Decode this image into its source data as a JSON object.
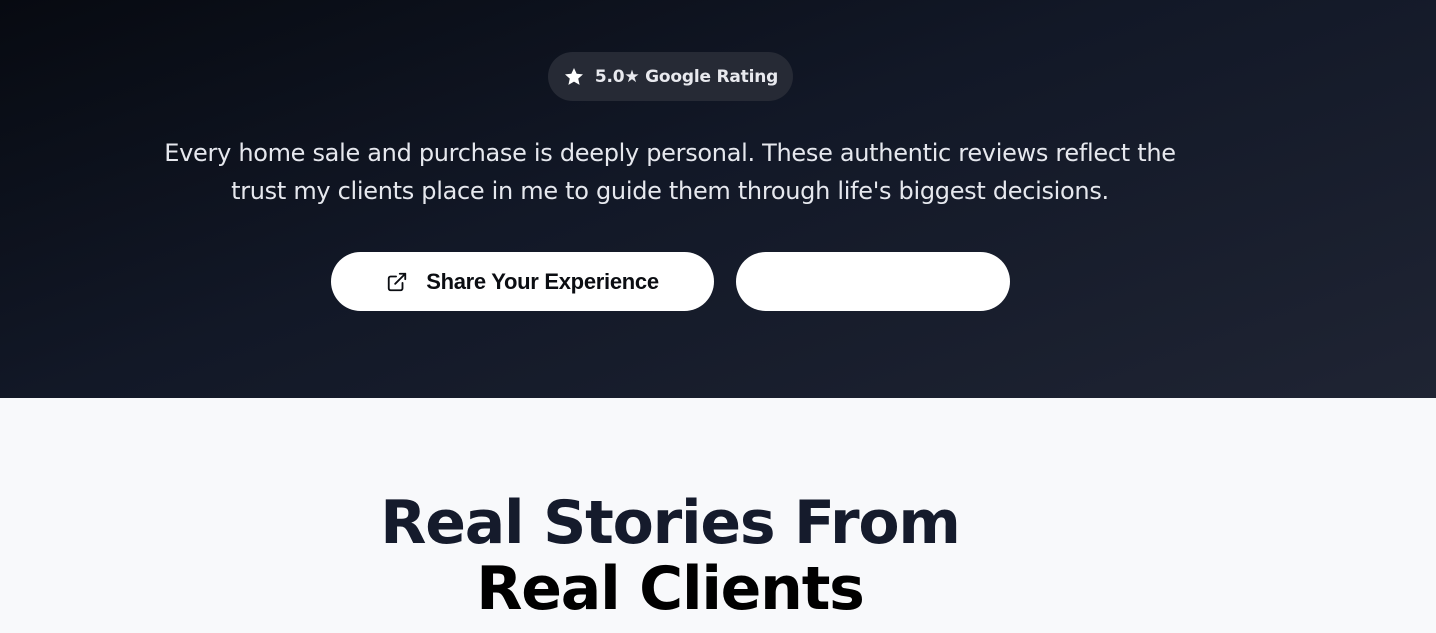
{
  "hero": {
    "rating_badge": {
      "icon": "star-icon",
      "label": "5.0★ Google Rating"
    },
    "intro_text": "Every home sale and purchase is deeply personal. These authentic reviews reflect the trust my clients place in me to guide them through life's biggest decisions.",
    "buttons": {
      "share": {
        "icon": "external-link-icon",
        "label": "Share Your Experience"
      },
      "secondary": {
        "label": ""
      }
    }
  },
  "reviews_section": {
    "heading_line1": "Real Stories From",
    "heading_line2": "Real Clients"
  },
  "colors": {
    "hero_bg_dark": "#070a11",
    "hero_bg_light": "#1f2433",
    "badge_bg": "#262a35",
    "button_bg": "#ffffff",
    "section_bg": "#f8f9fb",
    "heading_color": "#151b2c"
  }
}
